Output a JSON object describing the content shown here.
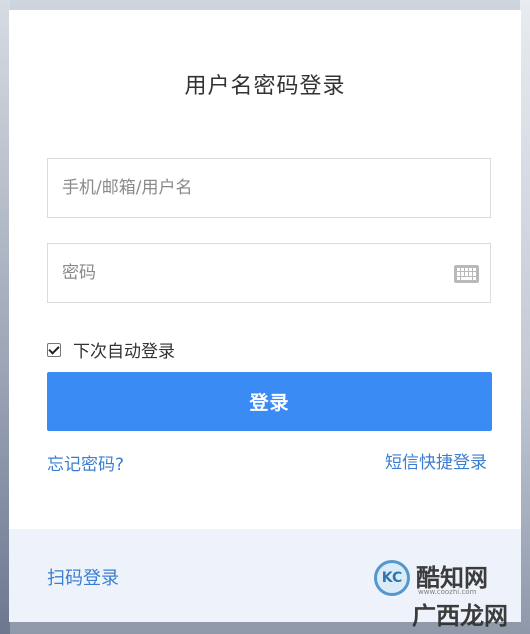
{
  "login": {
    "title": "用户名密码登录",
    "username_placeholder": "手机/邮箱/用户名",
    "password_placeholder": "密码",
    "remember_label": "下次自动登录",
    "remember_checked": true,
    "submit_label": "登录",
    "forgot_link": "忘记密码?",
    "sms_link": "短信快捷登录",
    "qr_link": "扫码登录"
  },
  "icons": {
    "keyboard": "keyboard-icon",
    "checkbox": "checkmark-icon"
  },
  "colors": {
    "primary_button": "#3b8bf5",
    "link": "#3b7ed0",
    "footer_bg": "#eef3fb"
  },
  "watermark": {
    "name": "酷知网",
    "url": "www.coozhi.com",
    "sub": "广西龙网",
    "badge": "KC"
  }
}
